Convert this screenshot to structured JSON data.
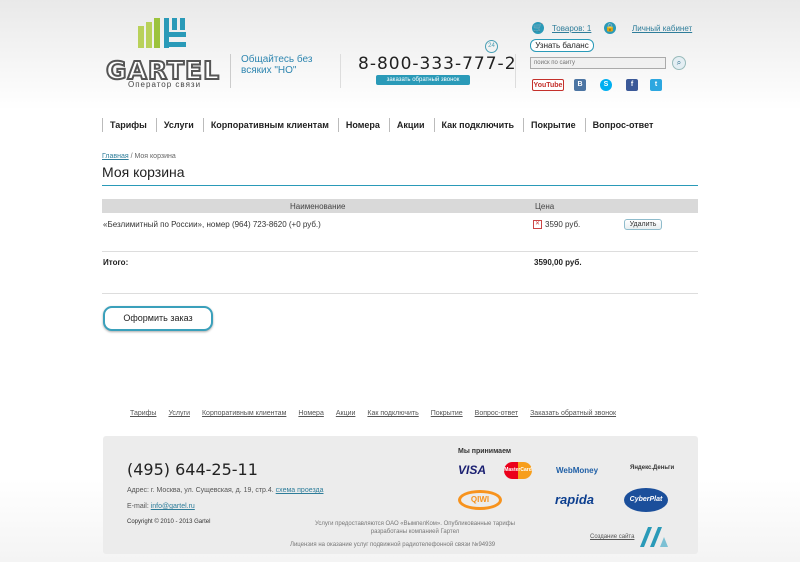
{
  "header": {
    "logo_word": "GARTEL",
    "logo_sub": "Оператор связи",
    "slogan": "Общайтесь без всяких \"НО\"",
    "phone": "8-800-333-777-2",
    "badge": "24",
    "callback": "заказать обратный звонок",
    "cart_link": "Товаров: 1",
    "cabinet_link": "Личный кабинет",
    "balance_button": "Узнать баланс",
    "search_placeholder": "поиск по сайту",
    "social": [
      {
        "label": "YouTube",
        "color": "#c4302b"
      },
      {
        "label": "B",
        "color": "#4c75a3"
      },
      {
        "label": "S",
        "color": "#00aff0"
      },
      {
        "label": "f",
        "color": "#3b5998"
      },
      {
        "label": "t",
        "color": "#2ca7e0"
      }
    ]
  },
  "nav": [
    "Тарифы",
    "Услуги",
    "Корпоративным клиентам",
    "Номера",
    "Акции",
    "Как подключить",
    "Покрытие",
    "Вопрос-ответ"
  ],
  "breadcrumbs": {
    "home": "Главная",
    "sep": " / ",
    "current": "Моя корзина"
  },
  "page_title": "Моя корзина",
  "cart": {
    "col_name": "Наименование",
    "col_price": "Цена",
    "item_name": "«Безлимитный по России», номер (964) 723-8620 (+0 руб.)",
    "item_price": "3590 руб.",
    "delete_button": "Удалить",
    "total_label": "Итого:",
    "total_value": "3590,00 руб.",
    "order_button": "Оформить заказ"
  },
  "footer_nav": [
    "Тарифы",
    "Услуги",
    "Корпоративным клиентам",
    "Номера",
    "Акции",
    "Как подключить",
    "Покрытие",
    "Вопрос-ответ",
    "Заказать обратный звонок"
  ],
  "footer": {
    "phone": "(495) 644-25-11",
    "address_prefix": "Адрес: г. Москва, ул. Сущевская, д. 19, стр.4.",
    "address_link": "схема проезда",
    "email_label": "E-mail: ",
    "email": "info@gartel.ru",
    "copyright": "Copyright © 2010 - 2013 Gartel",
    "accept_title": "Мы принимаем",
    "payments": [
      {
        "label": "VISA",
        "color": "#1a1f71"
      },
      {
        "label": "MasterCard",
        "color": "#eb001b"
      },
      {
        "label": "WebMoney",
        "color": "#1f5fa6"
      },
      {
        "label": "Яндекс.Деньги",
        "color": "#333333"
      },
      {
        "label": "QIWI",
        "color": "#f7931e"
      },
      {
        "label": "rapida",
        "color": "#0d3f8f"
      },
      {
        "label": "CyberPlat",
        "color": "#1b4f9b"
      }
    ],
    "note": "Услуги предоставляются ОАО «ВымпелКом». Опубликованные тарифы разработаны компанией Гартел",
    "license": "Лицензия на оказание услуг подвижной радиотелефонной связи №94939",
    "developer_link": "Создание сайта"
  }
}
